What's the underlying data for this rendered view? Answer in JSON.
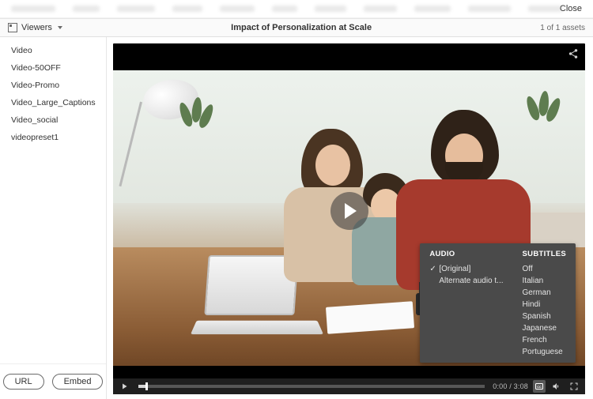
{
  "top": {
    "close": "Close"
  },
  "subbar": {
    "viewers_label": "Viewers",
    "title": "Impact of Personalization at Scale",
    "asset_counter": "1 of 1 assets"
  },
  "sidebar": {
    "presets": [
      {
        "label": "Video"
      },
      {
        "label": "Video-50OFF"
      },
      {
        "label": "Video-Promo"
      },
      {
        "label": "Video_Large_Captions"
      },
      {
        "label": "Video_social"
      },
      {
        "label": "videopreset1"
      }
    ],
    "url_btn": "URL",
    "embed_btn": "Embed"
  },
  "player": {
    "time": "0:00 / 3:08",
    "menu": {
      "audio_header": "AUDIO",
      "subs_header": "SUBTITLES",
      "audio": [
        {
          "label": "[Original]",
          "checked": true
        },
        {
          "label": "Alternate audio t...",
          "checked": false
        }
      ],
      "subs": [
        {
          "label": "Off"
        },
        {
          "label": "Italian"
        },
        {
          "label": "German"
        },
        {
          "label": "Hindi"
        },
        {
          "label": "Spanish"
        },
        {
          "label": "Japanese"
        },
        {
          "label": "French"
        },
        {
          "label": "Portuguese"
        }
      ]
    }
  }
}
